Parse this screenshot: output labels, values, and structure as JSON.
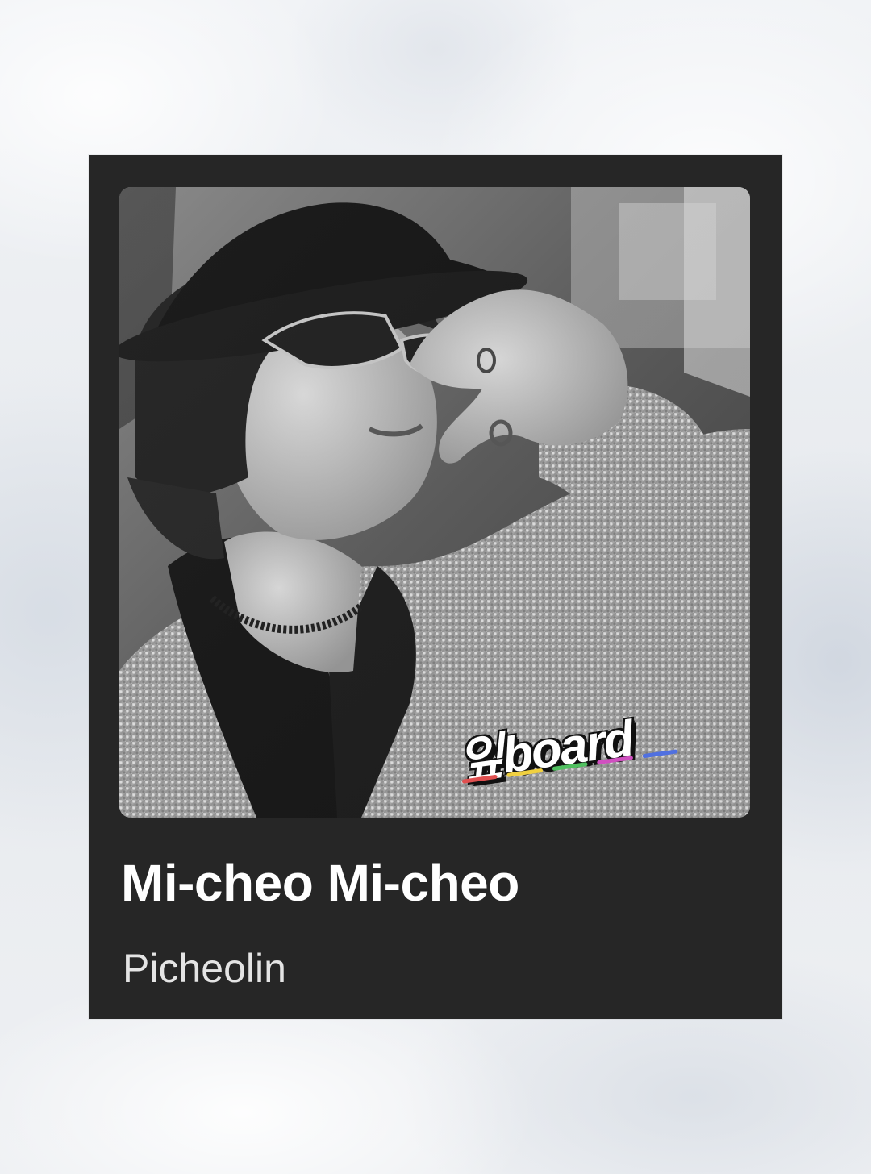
{
  "card": {
    "title": "Mi-cheo Mi-cheo",
    "artist": "Picheolin",
    "background_color": "#262626"
  },
  "artwork": {
    "style": "black-and-white photo",
    "icon": "album-cover",
    "logo_icon": "board-logo-sticker",
    "logo_colors": [
      "#e05050",
      "#f0d040",
      "#50c060",
      "#d050c0",
      "#5070e0"
    ]
  }
}
